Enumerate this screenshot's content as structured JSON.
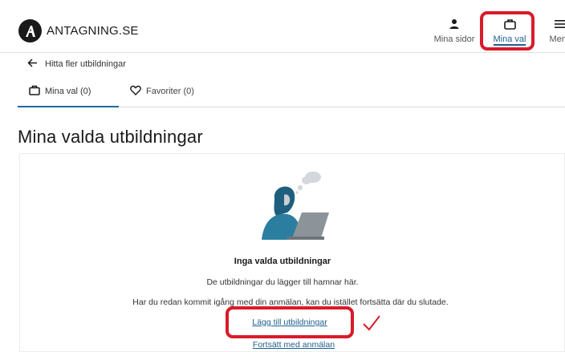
{
  "header": {
    "logo_text": "ANTAGNING.SE",
    "nav": [
      {
        "label": "Mina sidor",
        "icon": "person-icon"
      },
      {
        "label": "Mina val",
        "icon": "bag-icon",
        "active": true
      },
      {
        "label": "Meny",
        "icon": "hamburger-icon"
      }
    ]
  },
  "back_link": {
    "label": "Hitta fler utbildningar",
    "icon": "arrow-left-icon"
  },
  "tabs": [
    {
      "label": "Mina val (0)",
      "icon": "bag-icon",
      "active": true
    },
    {
      "label": "Favoriter (0)",
      "icon": "heart-icon"
    }
  ],
  "page_title": "Mina valda utbildningar",
  "empty_state": {
    "title": "Inga valda utbildningar",
    "subtitle": "De utbildningar du lägger till hamnar här.",
    "subtitle2": "Har du redan kommit igång med din anmälan, kan du istället fortsätta där du slutade.",
    "add_link": "Lägg till utbildningar",
    "continue_link": "Fortsätt med anmälan"
  },
  "colors": {
    "accent": "#1e5f8e",
    "highlight": "#d81b2a",
    "illustration": "#2b6e8e"
  }
}
